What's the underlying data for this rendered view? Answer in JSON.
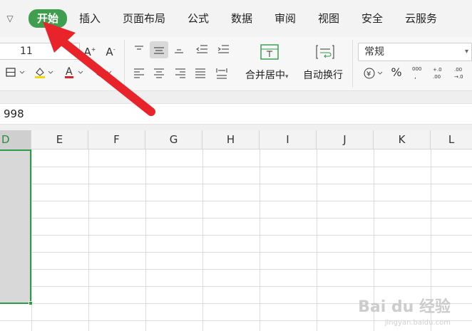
{
  "menu": {
    "tabs": [
      {
        "label": "开始",
        "active": true
      },
      {
        "label": "插入"
      },
      {
        "label": "页面布局"
      },
      {
        "label": "公式"
      },
      {
        "label": "数据"
      },
      {
        "label": "审阅"
      },
      {
        "label": "视图"
      },
      {
        "label": "安全"
      },
      {
        "label": "云服务"
      }
    ]
  },
  "ribbon": {
    "font_size": "11",
    "merge_center_label": "合并居中",
    "auto_wrap_label": "自动换行",
    "number_format": "常规",
    "currency_symbol": "¥",
    "percent_symbol": "%"
  },
  "formula_bar": {
    "value": "998"
  },
  "columns": [
    "D",
    "E",
    "F",
    "G",
    "H",
    "I",
    "J",
    "K",
    "L"
  ],
  "selected_column": "D",
  "colors": {
    "accent_green": "#3f9f4f",
    "arrow_red": "#e8232a"
  },
  "watermark": {
    "brand": "Bai du 经验",
    "url": "jingyan.baidu.com"
  }
}
